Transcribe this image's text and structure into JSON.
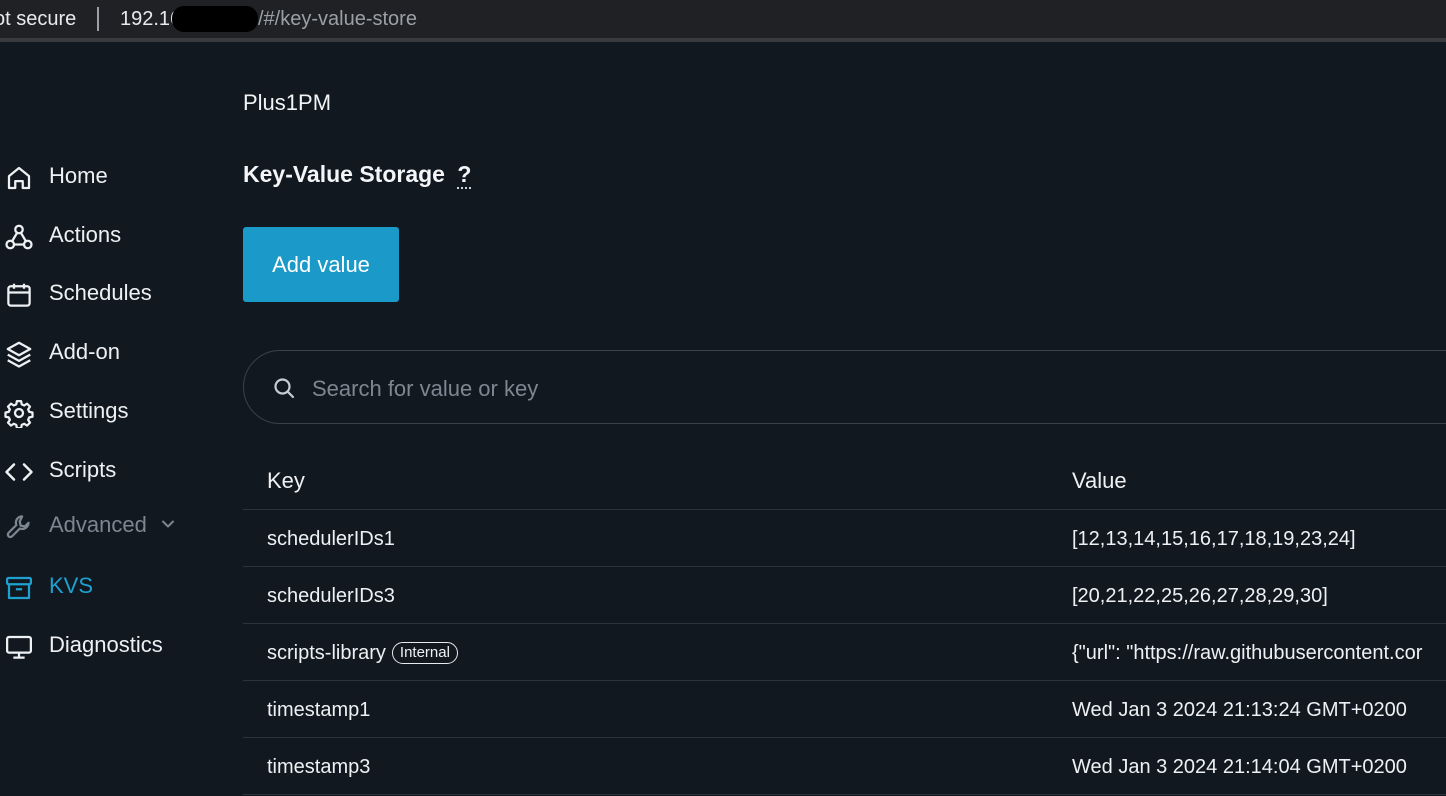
{
  "browser": {
    "security_label": "ot secure",
    "host": "192.16",
    "path": "/#/key-value-store"
  },
  "sidebar": {
    "items": [
      {
        "label": "Home",
        "icon": "home-icon"
      },
      {
        "label": "Actions",
        "icon": "webhook-icon"
      },
      {
        "label": "Schedules",
        "icon": "calendar-icon"
      },
      {
        "label": "Add-on",
        "icon": "layers-icon"
      },
      {
        "label": "Settings",
        "icon": "gear-icon"
      },
      {
        "label": "Scripts",
        "icon": "code-icon"
      },
      {
        "label": "Advanced",
        "icon": "wrench-icon",
        "disabled": true,
        "expandable": true
      },
      {
        "label": "KVS",
        "icon": "archive-icon",
        "active": true
      },
      {
        "label": "Diagnostics",
        "icon": "monitor-icon"
      }
    ]
  },
  "main": {
    "device_name": "Plus1PM",
    "title": "Key-Value Storage",
    "help_mark": "?",
    "add_button": "Add value",
    "search_placeholder": "Search for value or key",
    "table": {
      "columns": [
        "Key",
        "Value"
      ],
      "rows": [
        {
          "key": "schedulerIDs1",
          "value": "[12,13,14,15,16,17,18,19,23,24]"
        },
        {
          "key": "schedulerIDs3",
          "value": "[20,21,22,25,26,27,28,29,30]"
        },
        {
          "key": "scripts-library",
          "badge": "Internal",
          "value": "{\"url\": \"https://raw.githubusercontent.cor"
        },
        {
          "key": "timestamp1",
          "value": "Wed Jan 3 2024 21:13:24 GMT+0200"
        },
        {
          "key": "timestamp3",
          "value": "Wed Jan 3 2024 21:14:04 GMT+0200"
        }
      ]
    }
  },
  "colors": {
    "background": "#121820",
    "accent": "#1b99c8",
    "active_nav": "#1ea0d0",
    "disabled_nav": "#7c8691"
  }
}
